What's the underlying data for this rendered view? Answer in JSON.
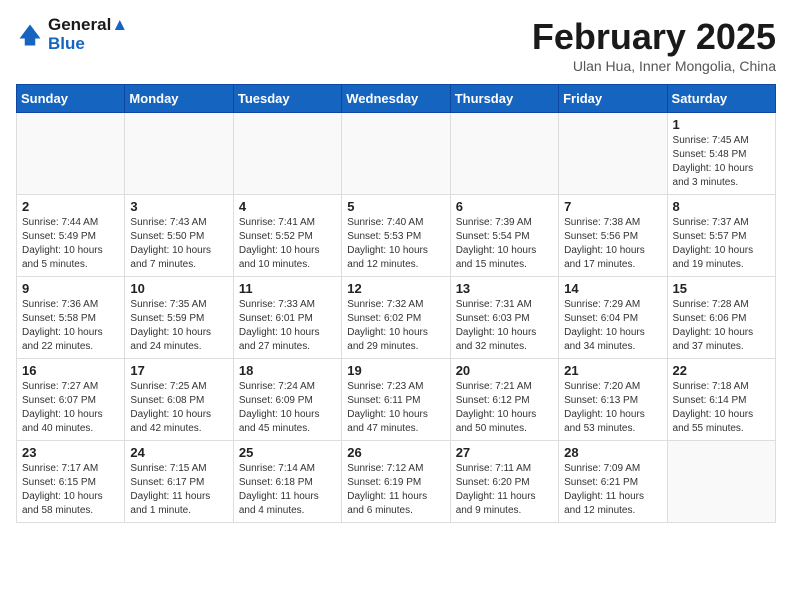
{
  "header": {
    "logo_line1": "General",
    "logo_line2": "Blue",
    "month": "February 2025",
    "location": "Ulan Hua, Inner Mongolia, China"
  },
  "days_of_week": [
    "Sunday",
    "Monday",
    "Tuesday",
    "Wednesday",
    "Thursday",
    "Friday",
    "Saturday"
  ],
  "weeks": [
    [
      {
        "day": "",
        "info": ""
      },
      {
        "day": "",
        "info": ""
      },
      {
        "day": "",
        "info": ""
      },
      {
        "day": "",
        "info": ""
      },
      {
        "day": "",
        "info": ""
      },
      {
        "day": "",
        "info": ""
      },
      {
        "day": "1",
        "info": "Sunrise: 7:45 AM\nSunset: 5:48 PM\nDaylight: 10 hours and 3 minutes."
      }
    ],
    [
      {
        "day": "2",
        "info": "Sunrise: 7:44 AM\nSunset: 5:49 PM\nDaylight: 10 hours and 5 minutes."
      },
      {
        "day": "3",
        "info": "Sunrise: 7:43 AM\nSunset: 5:50 PM\nDaylight: 10 hours and 7 minutes."
      },
      {
        "day": "4",
        "info": "Sunrise: 7:41 AM\nSunset: 5:52 PM\nDaylight: 10 hours and 10 minutes."
      },
      {
        "day": "5",
        "info": "Sunrise: 7:40 AM\nSunset: 5:53 PM\nDaylight: 10 hours and 12 minutes."
      },
      {
        "day": "6",
        "info": "Sunrise: 7:39 AM\nSunset: 5:54 PM\nDaylight: 10 hours and 15 minutes."
      },
      {
        "day": "7",
        "info": "Sunrise: 7:38 AM\nSunset: 5:56 PM\nDaylight: 10 hours and 17 minutes."
      },
      {
        "day": "8",
        "info": "Sunrise: 7:37 AM\nSunset: 5:57 PM\nDaylight: 10 hours and 19 minutes."
      }
    ],
    [
      {
        "day": "9",
        "info": "Sunrise: 7:36 AM\nSunset: 5:58 PM\nDaylight: 10 hours and 22 minutes."
      },
      {
        "day": "10",
        "info": "Sunrise: 7:35 AM\nSunset: 5:59 PM\nDaylight: 10 hours and 24 minutes."
      },
      {
        "day": "11",
        "info": "Sunrise: 7:33 AM\nSunset: 6:01 PM\nDaylight: 10 hours and 27 minutes."
      },
      {
        "day": "12",
        "info": "Sunrise: 7:32 AM\nSunset: 6:02 PM\nDaylight: 10 hours and 29 minutes."
      },
      {
        "day": "13",
        "info": "Sunrise: 7:31 AM\nSunset: 6:03 PM\nDaylight: 10 hours and 32 minutes."
      },
      {
        "day": "14",
        "info": "Sunrise: 7:29 AM\nSunset: 6:04 PM\nDaylight: 10 hours and 34 minutes."
      },
      {
        "day": "15",
        "info": "Sunrise: 7:28 AM\nSunset: 6:06 PM\nDaylight: 10 hours and 37 minutes."
      }
    ],
    [
      {
        "day": "16",
        "info": "Sunrise: 7:27 AM\nSunset: 6:07 PM\nDaylight: 10 hours and 40 minutes."
      },
      {
        "day": "17",
        "info": "Sunrise: 7:25 AM\nSunset: 6:08 PM\nDaylight: 10 hours and 42 minutes."
      },
      {
        "day": "18",
        "info": "Sunrise: 7:24 AM\nSunset: 6:09 PM\nDaylight: 10 hours and 45 minutes."
      },
      {
        "day": "19",
        "info": "Sunrise: 7:23 AM\nSunset: 6:11 PM\nDaylight: 10 hours and 47 minutes."
      },
      {
        "day": "20",
        "info": "Sunrise: 7:21 AM\nSunset: 6:12 PM\nDaylight: 10 hours and 50 minutes."
      },
      {
        "day": "21",
        "info": "Sunrise: 7:20 AM\nSunset: 6:13 PM\nDaylight: 10 hours and 53 minutes."
      },
      {
        "day": "22",
        "info": "Sunrise: 7:18 AM\nSunset: 6:14 PM\nDaylight: 10 hours and 55 minutes."
      }
    ],
    [
      {
        "day": "23",
        "info": "Sunrise: 7:17 AM\nSunset: 6:15 PM\nDaylight: 10 hours and 58 minutes."
      },
      {
        "day": "24",
        "info": "Sunrise: 7:15 AM\nSunset: 6:17 PM\nDaylight: 11 hours and 1 minute."
      },
      {
        "day": "25",
        "info": "Sunrise: 7:14 AM\nSunset: 6:18 PM\nDaylight: 11 hours and 4 minutes."
      },
      {
        "day": "26",
        "info": "Sunrise: 7:12 AM\nSunset: 6:19 PM\nDaylight: 11 hours and 6 minutes."
      },
      {
        "day": "27",
        "info": "Sunrise: 7:11 AM\nSunset: 6:20 PM\nDaylight: 11 hours and 9 minutes."
      },
      {
        "day": "28",
        "info": "Sunrise: 7:09 AM\nSunset: 6:21 PM\nDaylight: 11 hours and 12 minutes."
      },
      {
        "day": "",
        "info": ""
      }
    ]
  ]
}
